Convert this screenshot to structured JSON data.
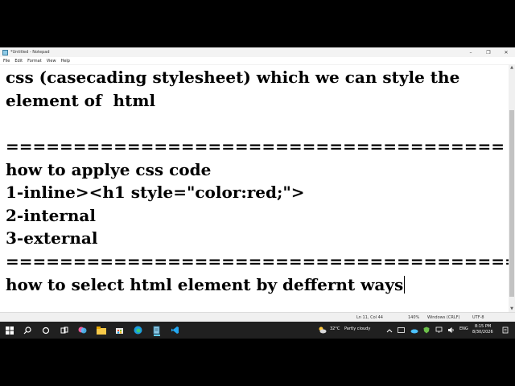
{
  "window": {
    "title": "*Untitled - Notepad",
    "minimize": "–",
    "maximize": "❐",
    "close": "✕"
  },
  "menu": {
    "items": [
      "File",
      "Edit",
      "Format",
      "View",
      "Help"
    ]
  },
  "editor": {
    "lines": [
      "css (casecading stylesheet) which we can style the",
      "element of  html",
      "",
      "=====================================",
      "how to applye css code",
      "1-inline><h1 style=\"color:red;\">",
      "2-internal",
      "3-external",
      "====================================================",
      "how to select html element by deffernt ways"
    ]
  },
  "statusbar": {
    "position": "Ln 11, Col 44",
    "zoom": "140%",
    "line_ending": "Windows (CRLF)",
    "encoding": "UTF-8"
  },
  "taskbar": {
    "weather_temp": "32°C",
    "weather_text": "Partly cloudy",
    "language": "ENG",
    "time": "8:15 PM",
    "date": "8/30/2026"
  }
}
